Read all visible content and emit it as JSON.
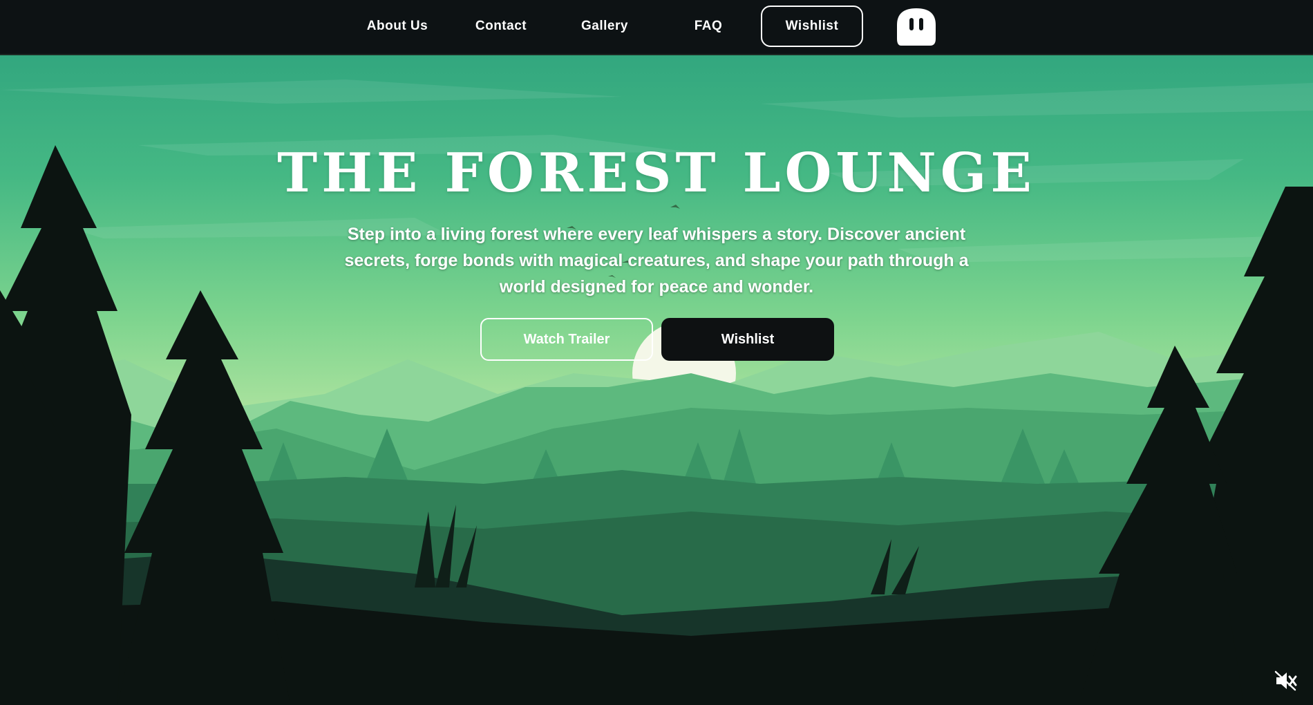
{
  "nav": {
    "links": [
      "About Us",
      "Contact",
      "Gallery",
      "FAQ"
    ],
    "wishlist_label": "Wishlist",
    "logo_icon": "ghost-pause-icon"
  },
  "hero": {
    "title": "THE FOREST LOUNGE",
    "description": "Step into a living forest where every leaf whispers a story. Discover ancient secrets, forge bonds with magical creatures, and shape your path through a world designed for peace and wonder.",
    "watch_trailer_label": "Watch Trailer",
    "wishlist_label": "Wishlist"
  },
  "controls": {
    "mute_icon": "volume-muted-icon"
  },
  "colors": {
    "nav_bg": "#0d1214",
    "sky_top": "#2fa77e",
    "sky_mid": "#5cc88a",
    "sky_low": "#a7e49a",
    "mountain_far": "#6cc48a",
    "mountain_mid": "#3f9e68",
    "forest_dark": "#0c1411",
    "button_dark": "#0e1112"
  }
}
